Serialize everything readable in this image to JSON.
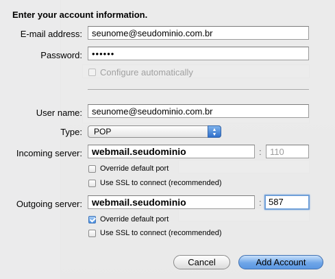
{
  "sheet": {
    "heading": "Enter your account information.",
    "email": {
      "label": "E-mail address:",
      "value": "seunome@seudominio.com.br"
    },
    "password": {
      "label": "Password:",
      "value": "••••••"
    },
    "configure_auto": {
      "label": "Configure automatically",
      "checked": false,
      "enabled": false
    },
    "username": {
      "label": "User name:",
      "value": "seunome@seudominio.com.br"
    },
    "type": {
      "label": "Type:",
      "value": "POP"
    },
    "incoming": {
      "label": "Incoming server:",
      "value": "webmail.seudominio",
      "colon": ":",
      "port": "110",
      "override_label": "Override default port",
      "override_checked": false,
      "ssl_label": "Use SSL to connect (recommended)",
      "ssl_checked": false
    },
    "outgoing": {
      "label": "Outgoing server:",
      "value": "webmail.seudominio",
      "colon": ":",
      "port": "587",
      "override_label": "Override default port",
      "override_checked": true,
      "ssl_label": "Use SSL to connect (recommended)",
      "ssl_checked": false
    },
    "buttons": {
      "cancel": "Cancel",
      "add": "Add Account"
    }
  },
  "colors": {
    "accent": "#5b97e2",
    "focus_ring": "#6f9fd8"
  }
}
